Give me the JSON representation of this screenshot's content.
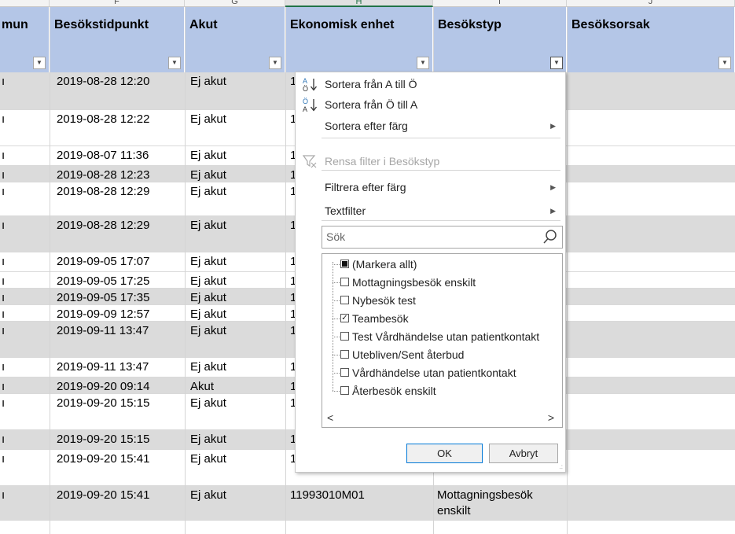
{
  "columns": [
    {
      "letter": "",
      "header": "mun"
    },
    {
      "letter": "F",
      "header": "Besökstidpunkt"
    },
    {
      "letter": "G",
      "header": "Akut"
    },
    {
      "letter": "H",
      "header": "Ekonomisk enhet"
    },
    {
      "letter": "I",
      "header": "Besökstyp"
    },
    {
      "letter": "J",
      "header": "Besöksorsak"
    }
  ],
  "rows": [
    {
      "e": "ı",
      "time": "2019-08-28 12:20",
      "akut": "Ej akut",
      "enhet": "1",
      "typ": "",
      "gray": true,
      "h": 48
    },
    {
      "e": "ı",
      "time": "2019-08-28 12:22",
      "akut": "Ej akut",
      "enhet": "1",
      "typ": "",
      "gray": false,
      "h": 46
    },
    {
      "e": "ı",
      "time": "2019-08-07 11:36",
      "akut": "Ej akut",
      "enhet": "1",
      "typ": "",
      "gray": false,
      "h": 25
    },
    {
      "e": "ı",
      "time": "2019-08-28 12:23",
      "akut": "Ej akut",
      "enhet": "1",
      "typ": "",
      "gray": true,
      "h": 21
    },
    {
      "e": "ı",
      "time": "2019-08-28 12:29",
      "akut": "Ej akut",
      "enhet": "1",
      "typ": "",
      "gray": false,
      "h": 43
    },
    {
      "e": "ı",
      "time": "2019-08-28 12:29",
      "akut": "Ej akut",
      "enhet": "1",
      "typ": "",
      "gray": true,
      "h": 46
    },
    {
      "e": "ı",
      "time": "2019-09-05 17:07",
      "akut": "Ej akut",
      "enhet": "1",
      "typ": "",
      "gray": false,
      "h": 25
    },
    {
      "e": "ı",
      "time": "2019-09-05 17:25",
      "akut": "Ej akut",
      "enhet": "1",
      "typ": "",
      "gray": false,
      "h": 21
    },
    {
      "e": "ı",
      "time": "2019-09-05 17:35",
      "akut": "Ej akut",
      "enhet": "1",
      "typ": "",
      "gray": true,
      "h": 21
    },
    {
      "e": "ı",
      "time": "2019-09-09 12:57",
      "akut": "Ej akut",
      "enhet": "1",
      "typ": "",
      "gray": false,
      "h": 21
    },
    {
      "e": "ı",
      "time": "2019-09-11 13:47",
      "akut": "Ej akut",
      "enhet": "1",
      "typ": "",
      "gray": true,
      "h": 46
    },
    {
      "e": "ı",
      "time": "2019-09-11 13:47",
      "akut": "Ej akut",
      "enhet": "1",
      "typ": "",
      "gray": false,
      "h": 25
    },
    {
      "e": "ı",
      "time": "2019-09-20 09:14",
      "akut": "Akut",
      "enhet": "1",
      "typ": "",
      "gray": true,
      "h": 21
    },
    {
      "e": "ı",
      "time": "2019-09-20 15:15",
      "akut": "Ej akut",
      "enhet": "1",
      "typ": "",
      "gray": false,
      "h": 46
    },
    {
      "e": "ı",
      "time": "2019-09-20 15:15",
      "akut": "Ej akut",
      "enhet": "1",
      "typ": "",
      "gray": true,
      "h": 25
    },
    {
      "e": "ı",
      "time": "2019-09-20 15:41",
      "akut": "Ej akut",
      "enhet": "1",
      "typ": "enskilt",
      "gray": false,
      "h": 46
    },
    {
      "e": "ı",
      "time": "2019-09-20 15:41",
      "akut": "Ej akut",
      "enhet": "11993010M01",
      "typ": "Mottagningsbesök enskilt",
      "gray": true,
      "h": 44
    }
  ],
  "menu": {
    "items": [
      {
        "label": "Sortera från A till Ö",
        "icon": "sort-a-to-o-icon",
        "arrow": false,
        "disabled": false
      },
      {
        "label": "Sortera från Ö till A",
        "icon": "sort-o-to-a-icon",
        "arrow": false,
        "disabled": false
      },
      {
        "label": "Sortera efter färg",
        "icon": "",
        "arrow": true,
        "disabled": false
      },
      {
        "label": "Rensa filter i Besökstyp",
        "icon": "clear-filter-icon",
        "arrow": false,
        "disabled": true
      },
      {
        "label": "Filtrera efter färg",
        "icon": "",
        "arrow": true,
        "disabled": false
      },
      {
        "label": "Textfilter",
        "icon": "",
        "arrow": true,
        "disabled": false
      }
    ],
    "search_placeholder": "Sök",
    "filter_values": [
      {
        "label": "(Markera allt)",
        "state": "partial"
      },
      {
        "label": "Mottagningsbesök enskilt",
        "state": "unchecked"
      },
      {
        "label": "Nybesök test",
        "state": "unchecked"
      },
      {
        "label": "Teambesök",
        "state": "checked"
      },
      {
        "label": "Test Vårdhändelse utan patientkontakt",
        "state": "unchecked"
      },
      {
        "label": "Utebliven/Sent återbud",
        "state": "unchecked"
      },
      {
        "label": "Vårdhändelse utan patientkontakt",
        "state": "unchecked"
      },
      {
        "label": "Återbesök enskilt",
        "state": "unchecked"
      }
    ],
    "ok_label": "OK",
    "cancel_label": "Avbryt"
  },
  "colors": {
    "header_fill": "#b4c6e7",
    "gray_row": "#dbdbdb",
    "accent": "#217346",
    "button_border": "#0078d7"
  }
}
